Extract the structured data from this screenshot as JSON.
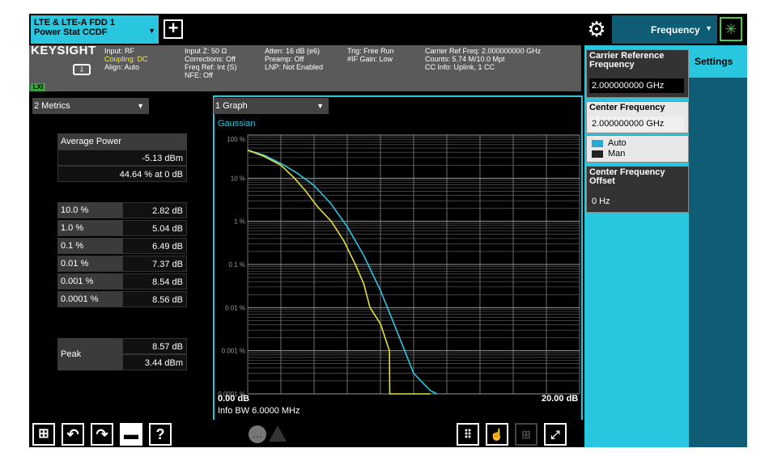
{
  "mode": {
    "line1": "LTE & LTE-A FDD 1",
    "line2": "Power Stat CCDF"
  },
  "toolbar": {
    "add_symbol": "+",
    "frequency_label": "Frequency"
  },
  "brand": {
    "logo_text": "KEYSIGHT",
    "lxi_label": "LXI"
  },
  "meas_bar": {
    "col1": [
      "Input: RF",
      "Coupling: DC",
      "Align: Auto"
    ],
    "col2": [
      "Input Z: 50 Ω",
      "Corrections: Off",
      "Freq Ref: Int (S)",
      "NFE: Off"
    ],
    "col3": [
      "Atten: 16 dB (e6)",
      "Preamp: Off",
      "LNP: Not Enabled"
    ],
    "col4": [
      "Trig: Free Run",
      "#IF Gain: Low"
    ],
    "col5": [
      "Carrier Ref Freq: 2.000000000 GHz",
      "Counts: 5.74 M/10.0 Mpt",
      "CC Info: Uplink, 1 CC"
    ]
  },
  "metrics": {
    "selector": "2 Metrics",
    "avg_power_label": "Average Power",
    "avg_power_value": "-5.13 dBm",
    "avg_pct_value": "44.64 % at 0 dB",
    "rows": [
      {
        "label": "10.0 %",
        "value": "2.82 dB"
      },
      {
        "label": "1.0 %",
        "value": "5.04 dB"
      },
      {
        "label": "0.1 %",
        "value": "6.49 dB"
      },
      {
        "label": "0.01 %",
        "value": "7.37 dB"
      },
      {
        "label": "0.001 %",
        "value": "8.54 dB"
      },
      {
        "label": "0.0001 %",
        "value": "8.56 dB"
      }
    ],
    "peak_label": "Peak",
    "peak_db": "8.57 dB",
    "peak_dbm": "3.44 dBm"
  },
  "graph": {
    "selector": "1 Graph",
    "trace_label": "Gaussian",
    "x_start": "0.00 dB",
    "x_stop": "20.00 dB",
    "info_bw": "Info BW 6.0000 MHz",
    "y_ticks": [
      "100 %",
      "10 %",
      "1 %",
      "0.1 %",
      "0.01 %",
      "0.001 %",
      "0.0001 %"
    ]
  },
  "chart_data": {
    "type": "line",
    "title": "Gaussian",
    "xlabel": "",
    "ylabel": "",
    "xlim": [
      0,
      20
    ],
    "y_scale": "log",
    "ylim": [
      0.0001,
      100
    ],
    "grid": true,
    "series": [
      {
        "name": "Gaussian",
        "color": "#29c6e0",
        "x": [
          0,
          1,
          2,
          3,
          4,
          5,
          6,
          7,
          8,
          9,
          10,
          11,
          11.4
        ],
        "y": [
          45,
          34,
          22,
          13,
          6.8,
          2.6,
          0.75,
          0.16,
          0.025,
          0.0028,
          0.0003,
          0.00012,
          0.0001
        ]
      },
      {
        "color": "#e8e03a",
        "x": [
          0,
          1,
          2,
          2.82,
          3.5,
          4.2,
          5.04,
          5.8,
          6.49,
          7.0,
          7.37,
          8.0,
          8.54,
          8.56,
          8.57
        ],
        "y": [
          44.6,
          32,
          20,
          10,
          5,
          2.2,
          1,
          0.35,
          0.1,
          0.035,
          0.01,
          0.0042,
          0.001,
          0.0001,
          0.0001
        ]
      }
    ]
  },
  "settings": {
    "tab_label": "Settings",
    "carrier_ref_label": "Carrier Reference Frequency",
    "carrier_ref_value": "2.000000000 GHz",
    "center_freq_label": "Center Frequency",
    "center_freq_value": "2.000000000 GHz",
    "auto_label": "Auto",
    "man_label": "Man",
    "center_offset_label": "Center Frequency Offset",
    "center_offset_value": "0 Hz"
  },
  "bottom": {
    "help_symbol": "?"
  }
}
